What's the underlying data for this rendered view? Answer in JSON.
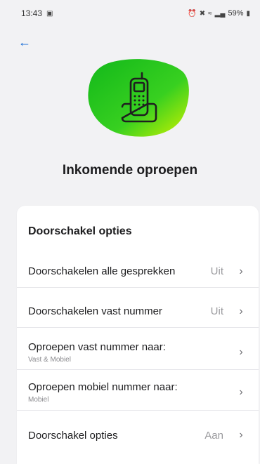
{
  "status_bar": {
    "time": "13:43",
    "battery": "59%"
  },
  "page": {
    "title": "Inkomende oproepen"
  },
  "card": {
    "title": "Doorschakel opties",
    "rows": [
      {
        "label": "Doorschakelen alle gesprekken",
        "value": "Uit",
        "sub": ""
      },
      {
        "label": "Doorschakelen vast nummer",
        "value": "Uit",
        "sub": ""
      },
      {
        "label": "Oproepen vast nummer naar:",
        "value": "",
        "sub": "Vast & Mobiel"
      },
      {
        "label": "Oproepen mobiel nummer naar:",
        "value": "",
        "sub": "Mobiel"
      },
      {
        "label": "Doorschakel opties",
        "value": "Aan",
        "sub": ""
      }
    ]
  },
  "colors": {
    "accent": "#1a6fd6",
    "blob_start": "#1fc41f",
    "blob_end": "#c8f000"
  }
}
